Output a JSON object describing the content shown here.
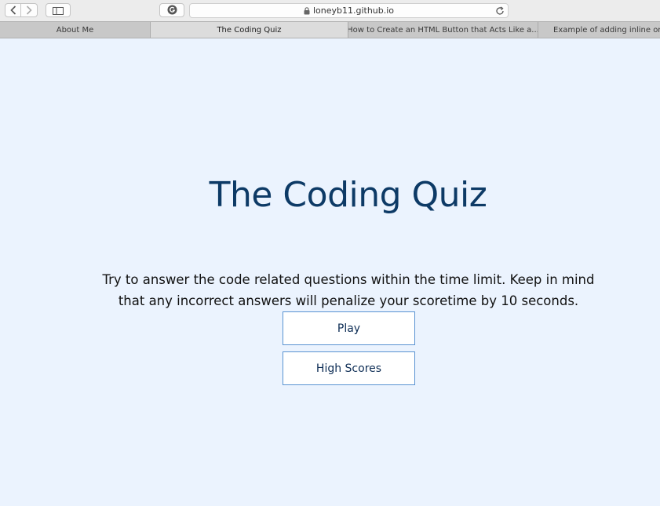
{
  "browser": {
    "url": "loneyb11.github.io",
    "tabs": [
      {
        "label": "About Me",
        "active": false
      },
      {
        "label": "The Coding Quiz",
        "active": true
      },
      {
        "label": "How to Create an HTML Button that Acts Like a...",
        "active": false
      },
      {
        "label": "Example of adding inline onclick",
        "active": false
      }
    ]
  },
  "page": {
    "title": "The Coding Quiz",
    "instructions": "Try to answer the code related questions within the time limit. Keep in mind that any incorrect answers will penalize your scoretime by 10 seconds.",
    "play_label": "Play",
    "high_scores_label": "High Scores"
  },
  "colors": {
    "background": "#ebf3fe",
    "title": "#0d3a66",
    "button_border": "#5a93d2"
  }
}
